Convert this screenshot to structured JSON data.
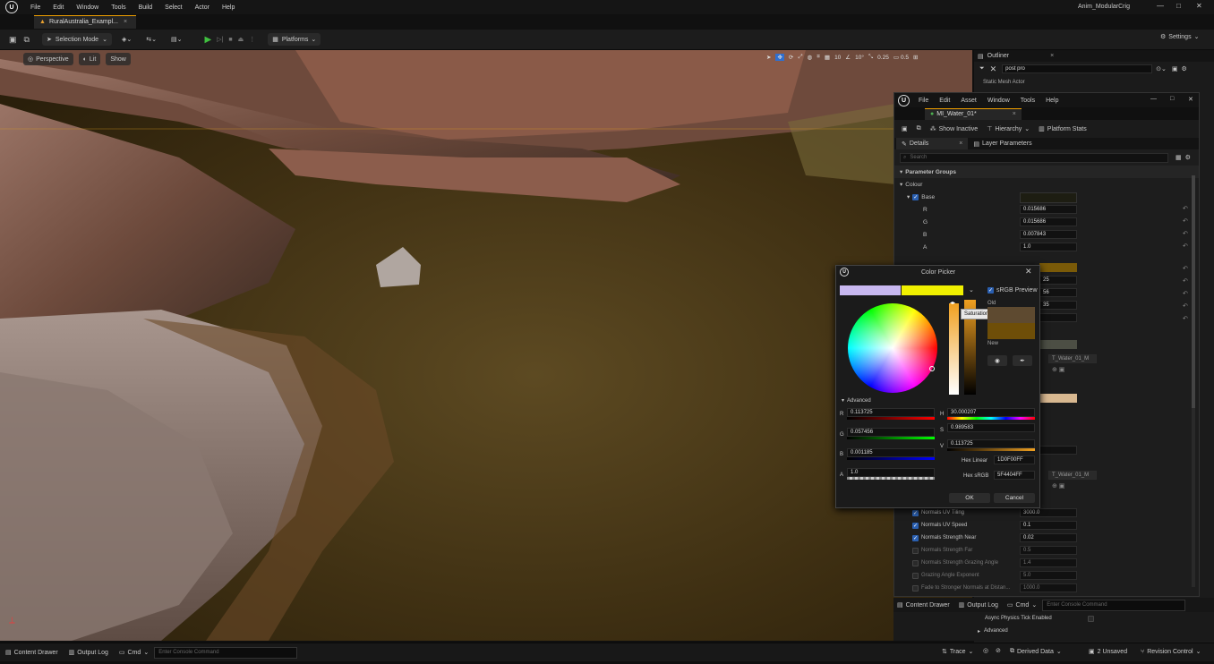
{
  "app": {
    "menu": [
      "File",
      "Edit",
      "Window",
      "Tools",
      "Build",
      "Select",
      "Actor",
      "Help"
    ],
    "project_name": "Anim_ModularCrig",
    "level_tab": "RuralAustralia_Exampl...",
    "win_min": "—",
    "win_max": "□",
    "win_close": "✕"
  },
  "toolbar": {
    "selection_mode": "Selection Mode",
    "platforms": "Platforms",
    "settings": "Settings"
  },
  "viewport": {
    "perspective": "Perspective",
    "lit": "Lit",
    "show": "Show",
    "snap_angle": "10",
    "snap_deg": "10°",
    "snap_scale": "0.25",
    "cam_speed": "0.5"
  },
  "outliner": {
    "title": "Outliner",
    "search_value": "post pro",
    "row": "Static Mesh Actor"
  },
  "material_editor": {
    "menu": [
      "File",
      "Edit",
      "Asset",
      "Window",
      "Tools",
      "Help"
    ],
    "tab": "MI_Water_01*",
    "show_inactive": "Show Inactive",
    "hierarchy": "Hierarchy",
    "platform_stats": "Platform Stats",
    "details_tab": "Details",
    "layer_params_tab": "Layer Parameters",
    "search_placeholder": "Search",
    "param_groups": "Parameter Groups",
    "colour_group": "Colour",
    "base_label": "Base",
    "base": {
      "r_label": "R",
      "r": "0.015686",
      "g_label": "G",
      "g": "0.015686",
      "b_label": "B",
      "b": "0.007843",
      "a_label": "A",
      "a": "1.0"
    },
    "partial_values": [
      "25",
      "56",
      "35"
    ],
    "texture_a": "T_Water_01_M",
    "texture_b": "T_Water_01_M",
    "rows": [
      {
        "label": "Normals UV Tiling",
        "value": "3000.0",
        "checked": true
      },
      {
        "label": "Normals UV Speed",
        "value": "0.1",
        "checked": true
      },
      {
        "label": "Normals Strength Near",
        "value": "0.02",
        "checked": true
      },
      {
        "label": "Normals Strength Far",
        "value": "0.5",
        "checked": false
      },
      {
        "label": "Normals Strength Grazing Angle",
        "value": "1.4",
        "checked": false
      },
      {
        "label": "Grazing Angle Exponent",
        "value": "5.0",
        "checked": false
      },
      {
        "label": "Fade to Stronger Normals at Distan...",
        "value": "1000.0",
        "checked": false
      }
    ]
  },
  "color_picker": {
    "title": "Color Picker",
    "srgb_preview": "sRGB Preview",
    "old_label": "Old",
    "new_label": "New",
    "tooltip": "Saturation",
    "advanced": "Advanced",
    "r_label": "R",
    "r": "0.113725",
    "g_label": "G",
    "g": "0.057456",
    "b_label": "B",
    "b": "0.001185",
    "a_label": "A",
    "a": "1.0",
    "h_label": "H",
    "h": "30.000207",
    "s_label": "S",
    "s": "0.989583",
    "v_label": "V",
    "v": "0.113725",
    "hex_linear_label": "Hex Linear",
    "hex_linear": "1D0F00FF",
    "hex_srgb_label": "Hex sRGB",
    "hex_srgb": "5F4404FF",
    "ok": "OK",
    "cancel": "Cancel"
  },
  "bottom_panel": {
    "content_drawer": "Content Drawer",
    "output_log": "Output Log",
    "cmd": "Cmd",
    "console_placeholder": "Enter Console Command",
    "async_physics": "Async Physics Tick Enabled",
    "advanced": "Advanced"
  },
  "statusbar": {
    "content_drawer": "Content Drawer",
    "output_log": "Output Log",
    "cmd": "Cmd",
    "console_placeholder": "Enter Console Command",
    "trace": "Trace",
    "derived_data": "Derived Data",
    "unsaved": "2 Unsaved",
    "revision_control": "Revision Control"
  }
}
